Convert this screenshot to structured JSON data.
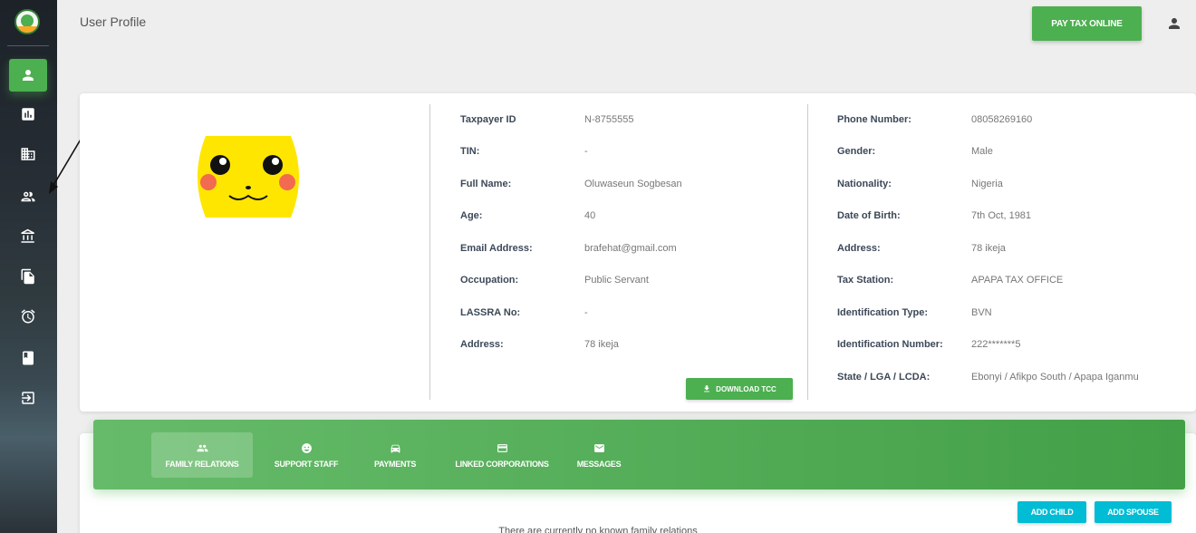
{
  "header": {
    "title": "User Profile",
    "pay_tax_label": "PAY TAX ONLINE"
  },
  "sidebar": {
    "items": [
      {
        "icon": "person-icon",
        "active": true
      },
      {
        "icon": "chart-icon"
      },
      {
        "icon": "building-icon"
      },
      {
        "icon": "people-icon"
      },
      {
        "icon": "bank-icon"
      },
      {
        "icon": "documents-icon"
      },
      {
        "icon": "alarm-icon"
      },
      {
        "icon": "book-icon"
      },
      {
        "icon": "logout-icon"
      }
    ]
  },
  "profile": {
    "left": [
      {
        "label": "Taxpayer ID",
        "value": "N-8755555"
      },
      {
        "label": "TIN:",
        "value": "-"
      },
      {
        "label": "Full Name:",
        "value": "Oluwaseun Sogbesan"
      },
      {
        "label": "Age:",
        "value": "40"
      },
      {
        "label": "Email Address:",
        "value": "brafehat@gmail.com"
      },
      {
        "label": "Occupation:",
        "value": "Public Servant"
      },
      {
        "label": "LASSRA No:",
        "value": "-"
      },
      {
        "label": "Address:",
        "value": "78 ikeja"
      }
    ],
    "right": [
      {
        "label": "Phone Number:",
        "value": "08058269160"
      },
      {
        "label": "Gender:",
        "value": "Male"
      },
      {
        "label": "Nationality:",
        "value": "Nigeria"
      },
      {
        "label": "Date of Birth:",
        "value": "7th Oct, 1981"
      },
      {
        "label": "Address:",
        "value": "78 ikeja"
      },
      {
        "label": "Tax Station:",
        "value": "APAPA TAX OFFICE"
      },
      {
        "label": "Identification Type:",
        "value": "BVN"
      },
      {
        "label": "Identification Number:",
        "value": "222*******5"
      },
      {
        "label": "State / LGA / LCDA:",
        "value": "Ebonyi / Afikpo South / Apapa Iganmu"
      }
    ],
    "download_label": "DOWNLOAD TCC"
  },
  "tabs": [
    {
      "label": "FAMILY RELATIONS",
      "icon": "family-icon",
      "active": true
    },
    {
      "label": "SUPPORT STAFF",
      "icon": "support-icon"
    },
    {
      "label": "PAYMENTS",
      "icon": "car-icon"
    },
    {
      "label": "LINKED CORPORATIONS",
      "icon": "card-icon"
    },
    {
      "label": "MESSAGES",
      "icon": "mail-icon"
    }
  ],
  "actions": {
    "add_child_label": "ADD CHILD",
    "add_spouse_label": "ADD SPOUSE"
  },
  "family": {
    "empty_text": "There are currently no known family relations"
  },
  "colors": {
    "primary": "#4caf50",
    "accent": "#00bcd4"
  }
}
